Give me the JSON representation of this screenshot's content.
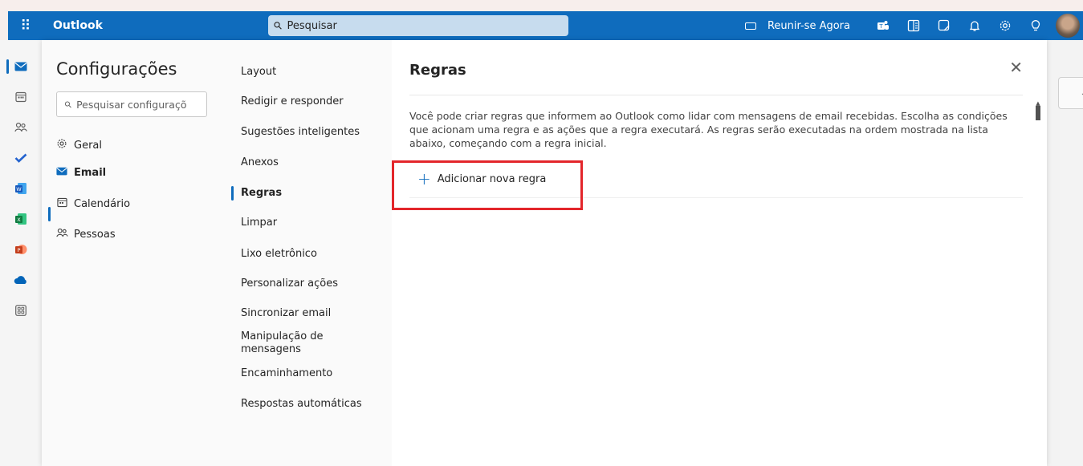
{
  "app": {
    "name": "Outlook",
    "waffle_glyph": "⠿"
  },
  "search": {
    "placeholder": "Pesquisar"
  },
  "topbar": {
    "meet_label": "Reunir-se Agora",
    "icons": [
      "teams-icon",
      "onenote-icon",
      "todo-icon",
      "bell-icon",
      "gear-icon",
      "lightbulb-icon"
    ]
  },
  "rail": [
    {
      "name": "mail-icon",
      "color": "#0f6cbd",
      "active": true
    },
    {
      "name": "calendar-icon",
      "color": "#616161"
    },
    {
      "name": "people-icon",
      "color": "#616161"
    },
    {
      "name": "todo-check-icon",
      "color": "#2564cf"
    },
    {
      "name": "word-icon",
      "color": "#185abd"
    },
    {
      "name": "excel-icon",
      "color": "#107c41"
    },
    {
      "name": "powerpoint-icon",
      "color": "#c43e1c"
    },
    {
      "name": "onedrive-icon",
      "color": "#0364b8"
    },
    {
      "name": "apps-icon",
      "color": "#616161"
    }
  ],
  "settings": {
    "title": "Configurações",
    "search_placeholder": "Pesquisar configuraçõ",
    "categories": [
      {
        "label": "Geral",
        "icon": "gear-icon"
      },
      {
        "label": "Email",
        "icon": "mail-icon",
        "active": true
      },
      {
        "label": "Calendário",
        "icon": "calendar-icon"
      },
      {
        "label": "Pessoas",
        "icon": "people-icon"
      }
    ]
  },
  "subnav": [
    {
      "label": "Layout"
    },
    {
      "label": "Redigir e responder"
    },
    {
      "label": "Sugestões inteligentes"
    },
    {
      "label": "Anexos"
    },
    {
      "label": "Regras",
      "active": true
    },
    {
      "label": "Limpar"
    },
    {
      "label": "Lixo eletrônico"
    },
    {
      "label": "Personalizar ações"
    },
    {
      "label": "Sincronizar email"
    },
    {
      "label": "Manipulação de mensagens"
    },
    {
      "label": "Encaminhamento"
    },
    {
      "label": "Respostas automáticas"
    }
  ],
  "pane": {
    "title": "Regras",
    "description": "Você pode criar regras que informem ao Outlook como lidar com mensagens de email recebidas. Escolha as condições que acionam uma regra e as ações que a regra executará. As regras serão executadas na ordem mostrada na lista abaixo, começando com a regra inicial.",
    "add_rule_label": "Adicionar nova regra"
  },
  "colors": {
    "accent": "#0f6cbd",
    "highlight": "#e3262b"
  }
}
